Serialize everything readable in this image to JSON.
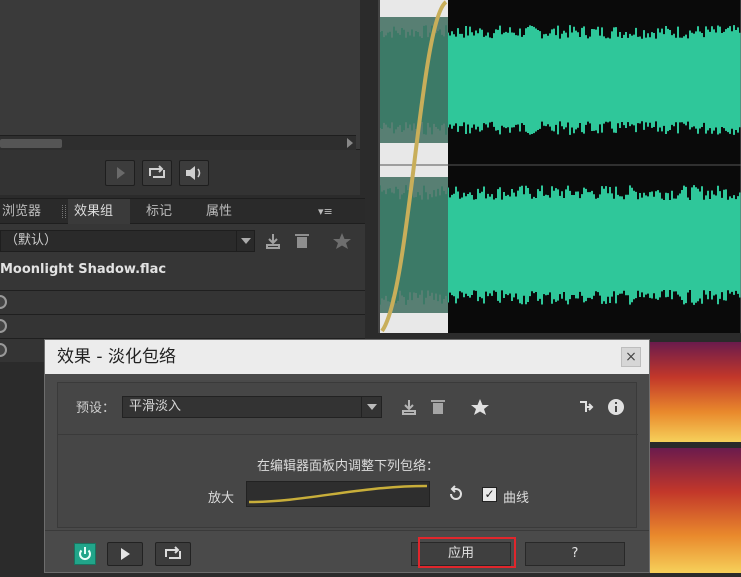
{
  "panel": {
    "tabs": [
      "浏览器",
      "效果组",
      "标记",
      "属性"
    ],
    "active_tab": "效果组",
    "close_glyph": "×",
    "menu_glyph": "▾≡",
    "preset_value": "（默认）",
    "filename": "Moonlight Shadow.flac"
  },
  "dialog": {
    "title": "效果 - 淡化包络",
    "close_glyph": "×",
    "preset_label": "预设：",
    "preset_value": "平滑淡入",
    "hint": "在编辑器面板内调整下列包络：",
    "zoom_label": "放大",
    "curve_checked": true,
    "curve_label": "曲线",
    "check_glyph": "✓",
    "apply_label": "应用",
    "close_label": "?"
  },
  "colors": {
    "waveform": "#2fc79a",
    "waveform_dim": "#3e6c5e",
    "fade_curve": "#c8ae5a",
    "highlight": "#e0262c",
    "power": "#21a58a"
  },
  "icons": {
    "play": "play-icon",
    "loop": "loop-icon",
    "speaker": "speaker-icon",
    "save": "save-preset-icon",
    "delete": "trash-icon",
    "favorite": "star-icon",
    "routing": "routing-icon",
    "info": "info-icon",
    "reset": "reset-icon",
    "power": "power-icon"
  }
}
